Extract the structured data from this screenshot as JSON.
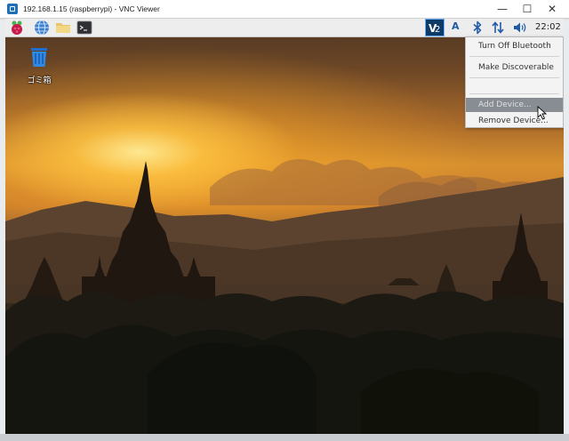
{
  "window": {
    "title": "192.168.1.15 (raspberrypi) - VNC Viewer",
    "minimize_glyph": "—",
    "maximize_glyph": "☐",
    "close_glyph": "✕"
  },
  "panel": {
    "launchers": [
      "raspberry-menu-icon",
      "web-browser-icon",
      "file-manager-icon",
      "terminal-icon"
    ],
    "tray": {
      "vnc_label": "V2",
      "a_label": "A",
      "clock": "22:02"
    }
  },
  "desktop": {
    "trash_label": "ゴミ箱"
  },
  "bluetooth_menu": {
    "items": [
      {
        "label": "Turn Off Bluetooth"
      },
      {
        "label": "Make Discoverable"
      },
      {
        "label": "Add Device..."
      },
      {
        "label": "Remove Device..."
      }
    ],
    "highlighted_index": 2
  },
  "colors": {
    "panel_bg": "#ededed",
    "menu_highlight": "#888c93",
    "vnc_tray_bg": "#0d3a67"
  }
}
